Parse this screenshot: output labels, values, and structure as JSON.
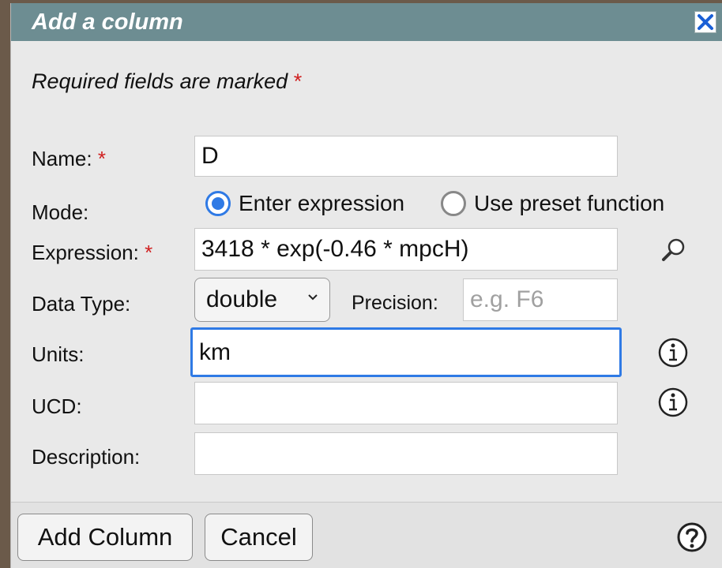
{
  "dialog": {
    "title": "Add a column",
    "required_note": "Required fields are marked",
    "required_marker": "*"
  },
  "fields": {
    "name_label": "Name:",
    "name_value": "D",
    "mode_label": "Mode:",
    "mode_options": [
      "Enter expression",
      "Use preset function"
    ],
    "mode_selected": "Enter expression",
    "expression_label": "Expression:",
    "expression_value": "3418 * exp(-0.46 * mpcH)",
    "datatype_label": "Data Type:",
    "datatype_value": "double",
    "precision_label": "Precision:",
    "precision_placeholder": "e.g. F6",
    "units_label": "Units:",
    "units_value": "km",
    "ucd_label": "UCD:",
    "ucd_value": "",
    "description_label": "Description:",
    "description_value": ""
  },
  "buttons": {
    "add_column": "Add Column",
    "cancel": "Cancel"
  },
  "icons": {
    "close": "close-icon",
    "search": "search-icon",
    "info": "info-icon",
    "help": "help-icon",
    "dropdown": "chevron-down-icon"
  },
  "colors": {
    "titlebar": "#6d8d92",
    "accent": "#2f7ae5",
    "required": "#d02020"
  }
}
